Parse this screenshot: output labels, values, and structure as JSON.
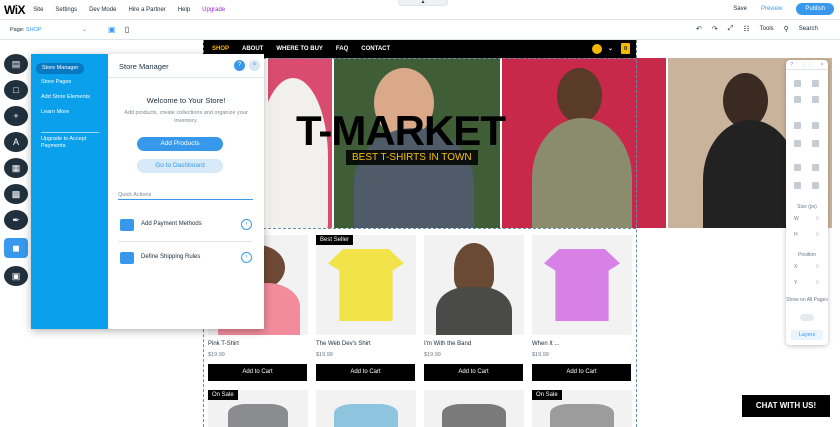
{
  "topbar": {
    "logo": "WiX",
    "menu": [
      "Site",
      "Settings",
      "Dev Mode",
      "Hire a Partner",
      "Help"
    ],
    "upgrade": "Upgrade",
    "save": "Save",
    "preview": "Preview",
    "publish": "Publish",
    "collapse_icon": "chevron-up-icon"
  },
  "toolbar": {
    "page_label": "Page:",
    "page_value": "SHOP",
    "tools": "Tools",
    "search": "Search"
  },
  "site": {
    "nav": [
      "SHOP",
      "ABOUT",
      "WHERE TO BUY",
      "FAQ",
      "CONTACT"
    ],
    "active_nav": "SHOP",
    "hero_title": "T-MARKET",
    "hero_subtitle": "BEST T-SHIRTS IN TOWN",
    "products": [
      {
        "name": "Pink T-Shirt",
        "price": "$19.99",
        "badge": ""
      },
      {
        "name": "The Web Dev's Shirt",
        "price": "$19.99",
        "badge": "Best Seller"
      },
      {
        "name": "I'm With the Band",
        "price": "$19.99",
        "badge": ""
      },
      {
        "name": "When It ...",
        "price": "$19.99",
        "badge": ""
      }
    ],
    "add_to_cart": "Add to Cart",
    "row2_badges": [
      "On Sale",
      "On Sale"
    ],
    "chat": "CHAT WITH US!",
    "colors": {
      "accent": "#f5b800",
      "wix_blue": "#3899ec",
      "store_blue": "#0aa0ec"
    }
  },
  "store_manager": {
    "nav": [
      "Store Manager",
      "Store Pages",
      "Add Store Elements",
      "Learn More"
    ],
    "nav_upgrade": "Upgrade to Accept Payments",
    "title": "Store Manager",
    "help": "?",
    "close": "×",
    "welcome": "Welcome to Your Store!",
    "description": "Add products, create collections and organize your inventory.",
    "add_products": "Add Products",
    "dashboard": "Go to Dashboard",
    "quick_actions": "Quick Actions",
    "actions": [
      "Add Payment Methods",
      "Define Shipping Rules"
    ]
  },
  "right_panel": {
    "size_label": "Size (px)",
    "w": "W",
    "h": "H",
    "position_label": "Position",
    "x": "X",
    "y": "Y",
    "field_value": "0",
    "show_on_all_pages": "Show on All Pages",
    "layers": "Layers"
  },
  "left_rail_icons": [
    "pages-icon",
    "background-icon",
    "add-icon",
    "design-icon",
    "app-market-icon",
    "media-icon",
    "blog-icon",
    "store-icon",
    "my-business-icon"
  ]
}
